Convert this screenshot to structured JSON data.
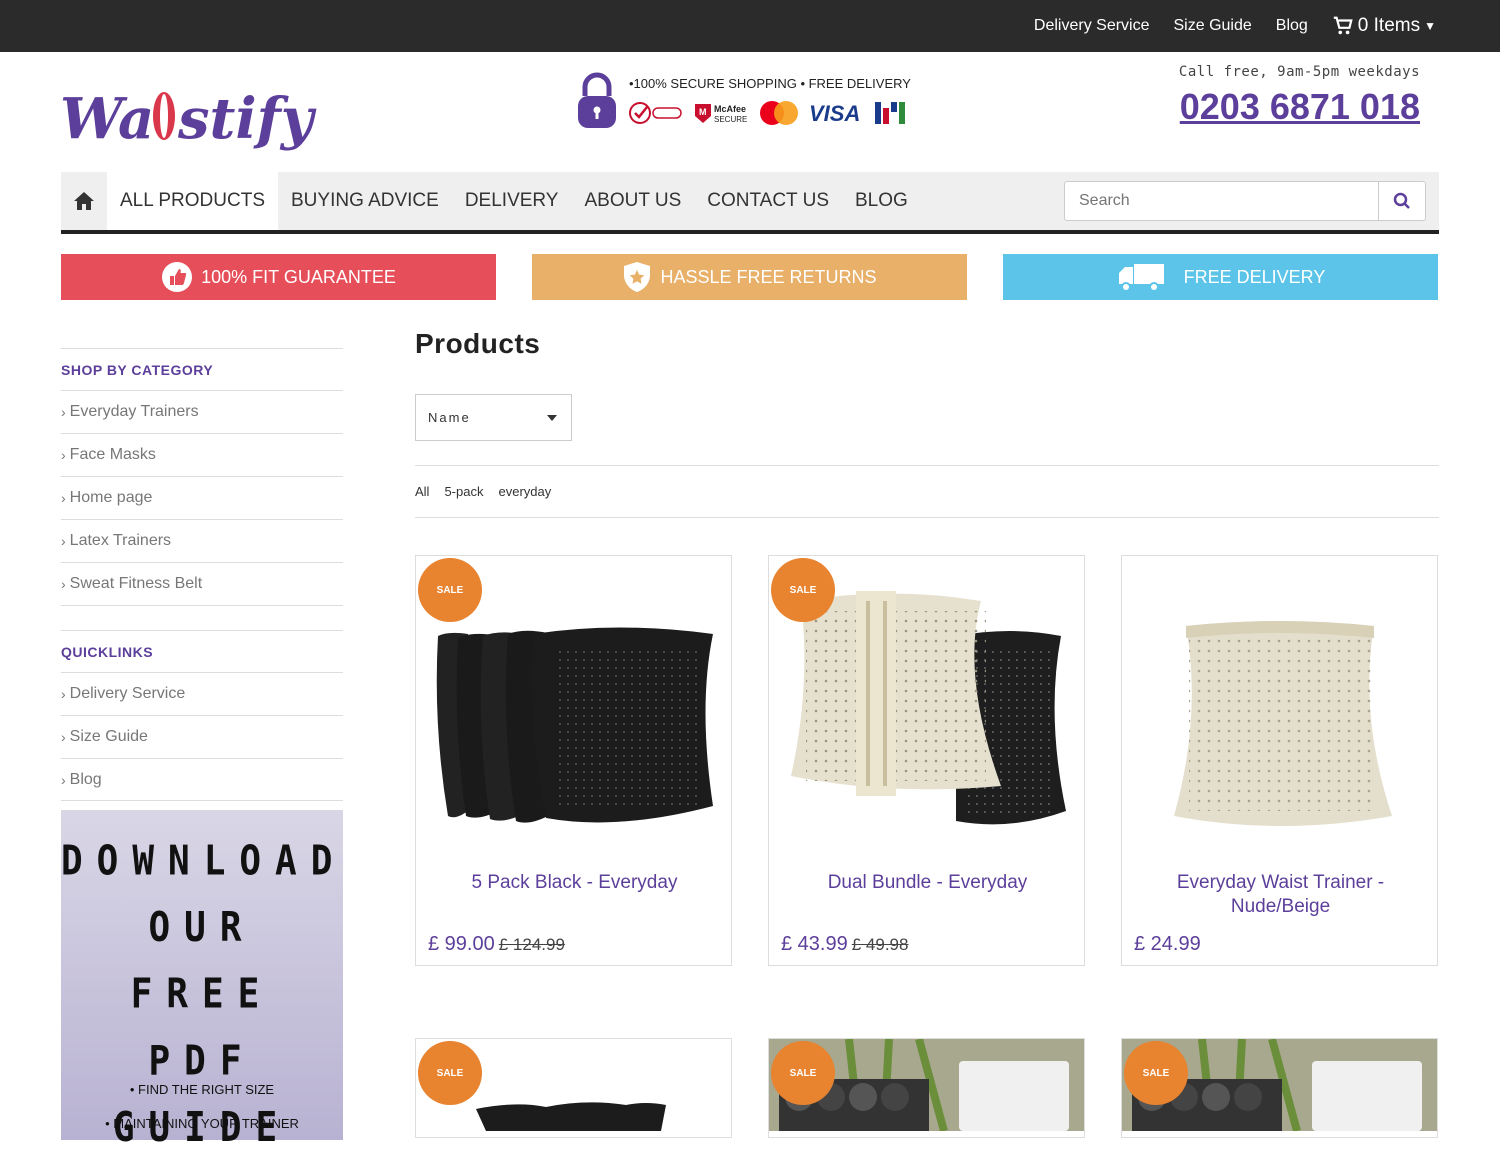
{
  "topbar": {
    "links": [
      "Delivery Service",
      "Size Guide",
      "Blog"
    ],
    "cart_label": "0 Items"
  },
  "brand": {
    "logo_text": "Waistify"
  },
  "secure": {
    "text": "•100% SECURE SHOPPING • FREE DELIVERY",
    "badges": [
      "verified",
      "McAfee SECURE",
      "MasterCard",
      "VISA",
      "secure"
    ]
  },
  "contact": {
    "label": "Call free, 9am-5pm weekdays",
    "phone": "0203 6871 018"
  },
  "nav": {
    "items": [
      "ALL PRODUCTS",
      "BUYING ADVICE",
      "DELIVERY",
      "ABOUT US",
      "CONTACT US",
      "BLOG"
    ],
    "search_placeholder": "Search"
  },
  "banners": [
    "100% FIT GUARANTEE",
    "HASSLE FREE RETURNS",
    "FREE DELIVERY"
  ],
  "sidebar": {
    "category_title": "SHOP BY CATEGORY",
    "categories": [
      "Everyday Trainers",
      "Face Masks",
      "Home page",
      "Latex Trainers",
      "Sweat Fitness Belt"
    ],
    "quicklinks_title": "QUICKLINKS",
    "quicklinks": [
      "Delivery Service",
      "Size Guide",
      "Blog"
    ],
    "promo_lines": [
      "DOWNLOAD",
      "OUR FREE",
      "PDF GUIDE"
    ],
    "promo_bullets": [
      "• FIND THE RIGHT SIZE",
      "• MAINTAINING YOUR TRAINER"
    ]
  },
  "main": {
    "title": "Products",
    "sort_value": "Name",
    "filters": [
      "All",
      "5-pack",
      "everyday"
    ],
    "sale_label": "SALE",
    "products": [
      {
        "name": "5 Pack Black - Everyday",
        "price": "£ 99.00",
        "old_price": "£ 124.99",
        "sale": true
      },
      {
        "name": "Dual Bundle - Everyday",
        "price": "£ 43.99",
        "old_price": "£ 49.98",
        "sale": true
      },
      {
        "name": "Everyday Waist Trainer - Nude/Beige",
        "price": "£ 24.99",
        "old_price": "",
        "sale": false
      }
    ]
  },
  "colors": {
    "brand_purple": "#5c3f9b",
    "fit_red": "#e64e59",
    "returns_orange": "#e8b069",
    "delivery_blue": "#5bc4e8",
    "sale_orange": "#e8832f"
  }
}
